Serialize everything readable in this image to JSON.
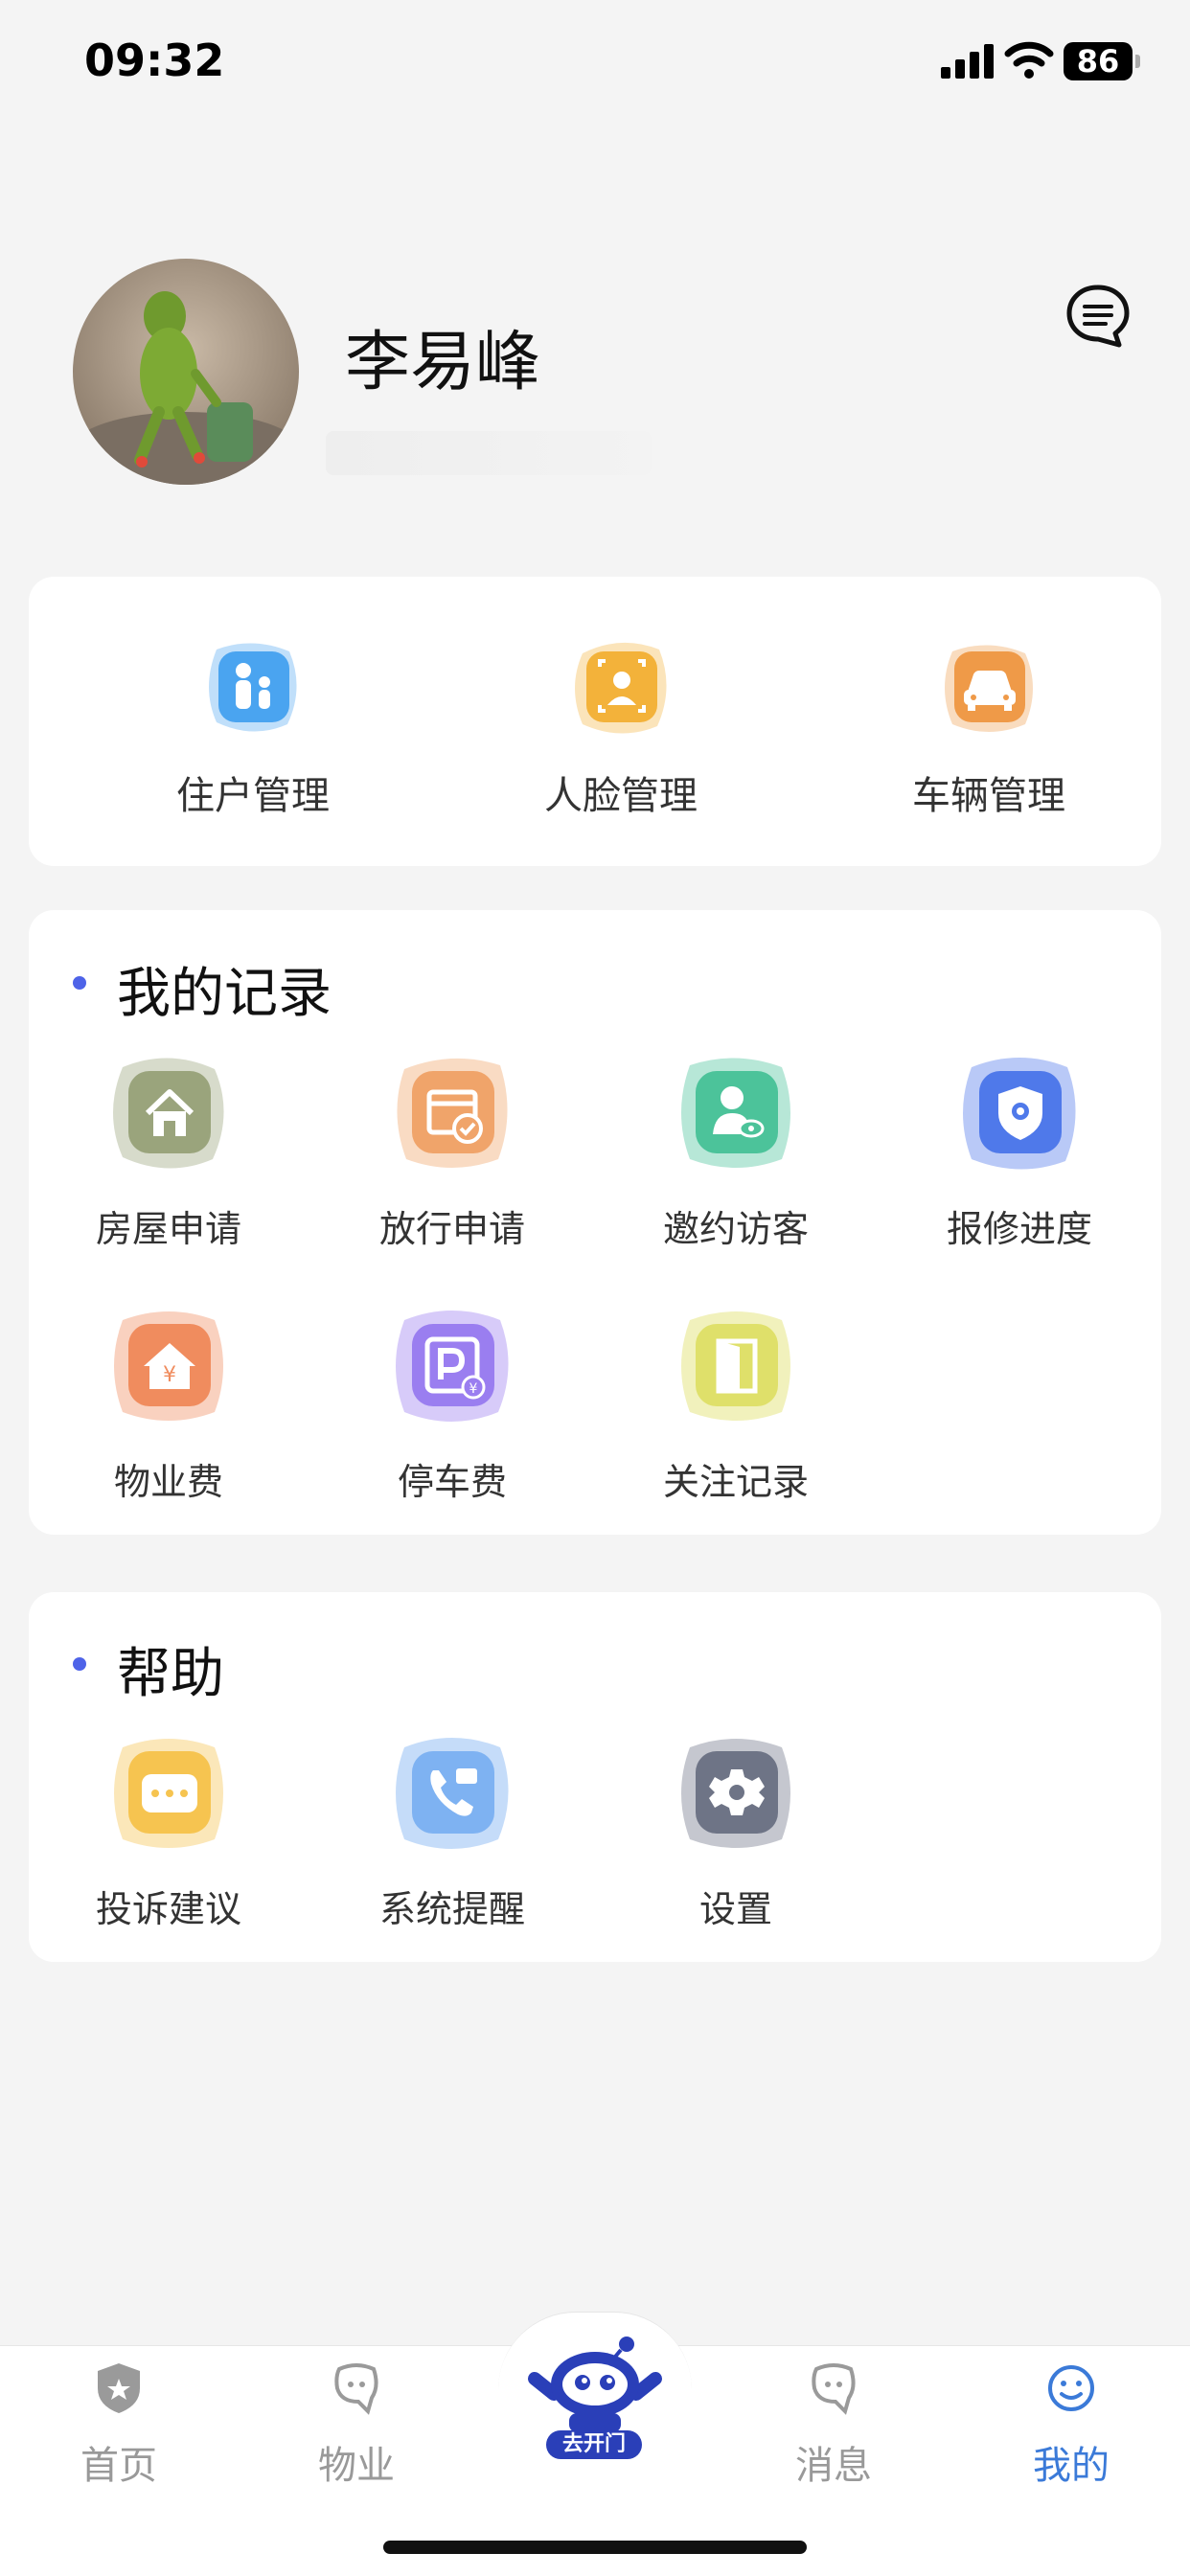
{
  "status": {
    "time": "09:32",
    "battery": "86"
  },
  "profile": {
    "name": "李易峰"
  },
  "quick_actions": [
    {
      "label": "住户管理",
      "icon": "household-icon",
      "color": "#4aa4f0"
    },
    {
      "label": "人脸管理",
      "icon": "face-id-icon",
      "color": "#f3b23a"
    },
    {
      "label": "车辆管理",
      "icon": "car-icon",
      "color": "#ef9a48"
    }
  ],
  "records": {
    "title": "我的记录",
    "items": [
      {
        "label": "房屋申请",
        "icon": "house-icon",
        "color": "#9aa47c"
      },
      {
        "label": "放行申请",
        "icon": "release-pass-icon",
        "color": "#f0a46a"
      },
      {
        "label": "邀约访客",
        "icon": "visitor-icon",
        "color": "#4cc39a"
      },
      {
        "label": "报修进度",
        "icon": "repair-shield-icon",
        "color": "#4f79ea"
      },
      {
        "label": "物业费",
        "icon": "property-fee-icon",
        "color": "#f08c5e"
      },
      {
        "label": "停车费",
        "icon": "parking-fee-icon",
        "color": "#9a7ef0"
      },
      {
        "label": "关注记录",
        "icon": "door-icon",
        "color": "#dfe06a"
      }
    ]
  },
  "help": {
    "title": "帮助",
    "items": [
      {
        "label": "投诉建议",
        "icon": "feedback-icon",
        "color": "#f6c450"
      },
      {
        "label": "系统提醒",
        "icon": "phone-reminder-icon",
        "color": "#7eb2f2"
      },
      {
        "label": "设置",
        "icon": "settings-gear-icon",
        "color": "#6e7486"
      }
    ]
  },
  "tabbar": {
    "home": "首页",
    "property": "物业",
    "open_door": "去开门",
    "messages": "消息",
    "mine": "我的",
    "active_color": "#3b7ad8"
  }
}
